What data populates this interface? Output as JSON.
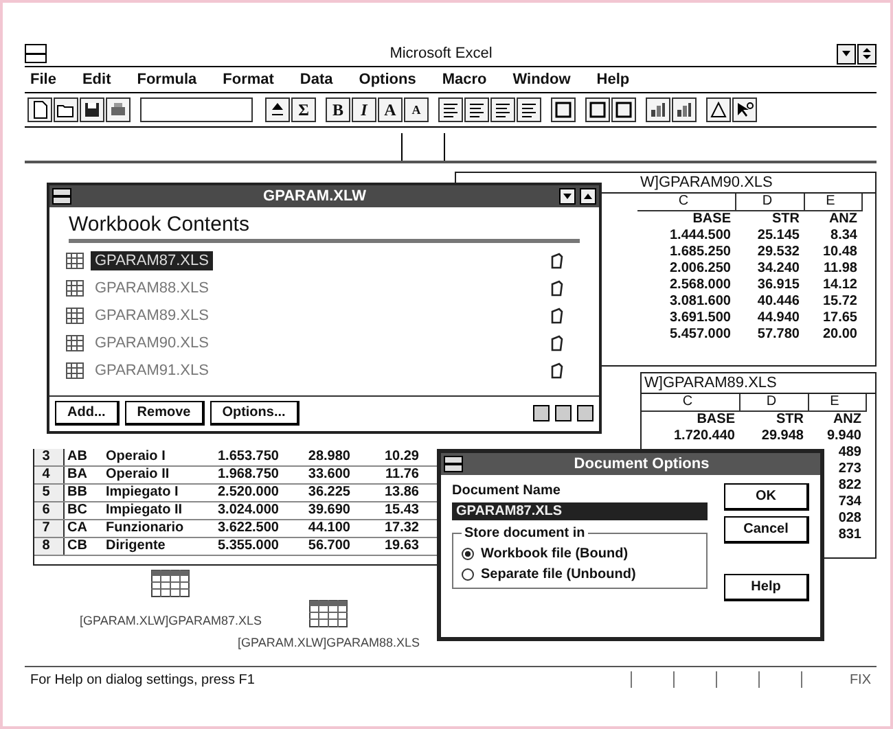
{
  "window": {
    "title": "Microsoft Excel"
  },
  "menu": [
    "File",
    "Edit",
    "Formula",
    "Format",
    "Data",
    "Options",
    "Macro",
    "Window",
    "Help"
  ],
  "toolbar": {
    "glyphs": [
      "Σ",
      "B",
      "I",
      "A",
      "A"
    ]
  },
  "sheet_90": {
    "title": "W]GPARAM90.XLS",
    "columns": [
      "C",
      "D",
      "E"
    ],
    "rows": [
      [
        "BASE",
        "STR",
        "ANZ"
      ],
      [
        "1.444.500",
        "25.145",
        "8.34"
      ],
      [
        "1.685.250",
        "29.532",
        "10.48"
      ],
      [
        "2.006.250",
        "34.240",
        "11.98"
      ],
      [
        "2.568.000",
        "36.915",
        "14.12"
      ],
      [
        "3.081.600",
        "40.446",
        "15.72"
      ],
      [
        "3.691.500",
        "44.940",
        "17.65"
      ],
      [
        "5.457.000",
        "57.780",
        "20.00"
      ]
    ]
  },
  "sheet_89": {
    "title": "W]GPARAM89.XLS",
    "columns": [
      "C",
      "D",
      "E"
    ],
    "rows": [
      [
        "BASE",
        "STR",
        "ANZ"
      ],
      [
        "1.720.440",
        "29.948",
        "9.940"
      ],
      [
        null,
        null,
        "489"
      ],
      [
        null,
        null,
        "273"
      ],
      [
        null,
        null,
        "822"
      ],
      [
        null,
        null,
        "734"
      ],
      [
        null,
        null,
        "028"
      ],
      [
        null,
        null,
        "831"
      ]
    ]
  },
  "sheet_87": {
    "rows": [
      [
        "3",
        "AB",
        "Operaio I",
        "1.653.750",
        "28.980",
        "10.29"
      ],
      [
        "4",
        "BA",
        "Operaio II",
        "1.968.750",
        "33.600",
        "11.76"
      ],
      [
        "5",
        "BB",
        "Impiegato I",
        "2.520.000",
        "36.225",
        "13.86"
      ],
      [
        "6",
        "BC",
        "Impiegato II",
        "3.024.000",
        "39.690",
        "15.43"
      ],
      [
        "7",
        "CA",
        "Funzionario",
        "3.622.500",
        "44.100",
        "17.32"
      ],
      [
        "8",
        "CB",
        "Dirigente",
        "5.355.000",
        "56.700",
        "19.63"
      ]
    ]
  },
  "workbook": {
    "title": "GPARAM.XLW",
    "heading": "Workbook Contents",
    "items": [
      {
        "label": "GPARAM87.XLS",
        "selected": true
      },
      {
        "label": "GPARAM88.XLS",
        "selected": false
      },
      {
        "label": "GPARAM89.XLS",
        "selected": false
      },
      {
        "label": "GPARAM90.XLS",
        "selected": false
      },
      {
        "label": "GPARAM91.XLS",
        "selected": false
      }
    ],
    "buttons": [
      "Add...",
      "Remove",
      "Options..."
    ]
  },
  "dialog": {
    "title": "Document Options",
    "name_label": "Document Name",
    "name_value": "GPARAM87.XLS",
    "group_label": "Store document in",
    "options": [
      {
        "label": "Workbook file (Bound)",
        "selected": true
      },
      {
        "label": "Separate file (Unbound)",
        "selected": false
      }
    ],
    "buttons": [
      "OK",
      "Cancel",
      "Help"
    ]
  },
  "minimized": [
    {
      "label": "[GPARAM.XLW]GPARAM87.XLS"
    },
    {
      "label": "[GPARAM.XLW]GPARAM88.XLS"
    }
  ],
  "status_bar": {
    "text": "For Help on dialog settings, press F1",
    "indicator": "FIX"
  }
}
